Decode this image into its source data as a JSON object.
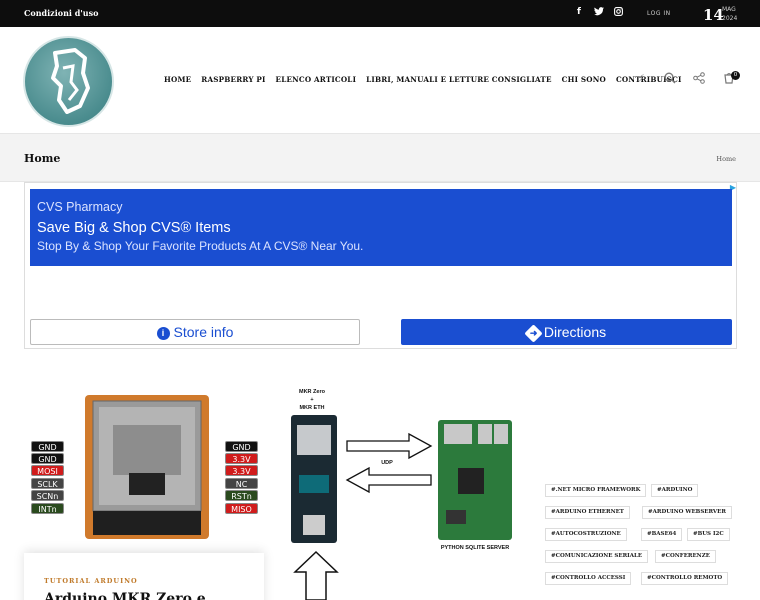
{
  "topbar": {
    "terms": "Condizioni d'uso",
    "social": [
      "f",
      "🐦",
      "◎"
    ],
    "login": "LOG IN",
    "day": "14",
    "month": "MAG",
    "year": "2024"
  },
  "nav": {
    "items": [
      "HOME",
      "RASPBERRY PI",
      "ELENCO ARTICOLI",
      "LIBRI, MANUALI E LETTURE CONSIGLIATE",
      "CHI SONO",
      "CONTRIBUISCI"
    ],
    "cart_count": "0"
  },
  "breadcrumb": {
    "title": "Home",
    "crumb": "Home"
  },
  "ad": {
    "brand": "CVS Pharmacy",
    "headline": "Save Big & Shop CVS® Items",
    "subline": "Stop By & Shop Your Favorite Products At A CVS® Near You.",
    "store_button": "Store info",
    "directions_button": "Directions",
    "accent": "#1a4ed1"
  },
  "diagram": {
    "left_pins": [
      "GND",
      "GND",
      "MOSI",
      "SCLK",
      "SCNn",
      "INTn"
    ],
    "right_pins": [
      "GND",
      "3.3V",
      "3.3V",
      "NC",
      "RSTn",
      "MISO"
    ],
    "board_label_1": "MKR Zero",
    "board_label_plus": "+",
    "board_label_2": "MKR ETH",
    "udp_label": "UDP",
    "server_label": "PYTHON SQLITE SERVER"
  },
  "post": {
    "category": "TUTORIAL ARDUINO",
    "title": "Arduino MKR Zero e"
  },
  "tags": [
    "#.NET MICRO FRAMEWORK",
    "#ARDUINO",
    "#ARDUINO ETHERNET",
    "#ARDUINO WEBSERVER",
    "#AUTOCOSTRUZIONE",
    "#BASE64",
    "#BUS I2C",
    "#COMUNICAZIONE SERIALE",
    "#CONFERENZE",
    "#CONTROLLO ACCESSI",
    "#CONTROLLO REMOTO"
  ]
}
